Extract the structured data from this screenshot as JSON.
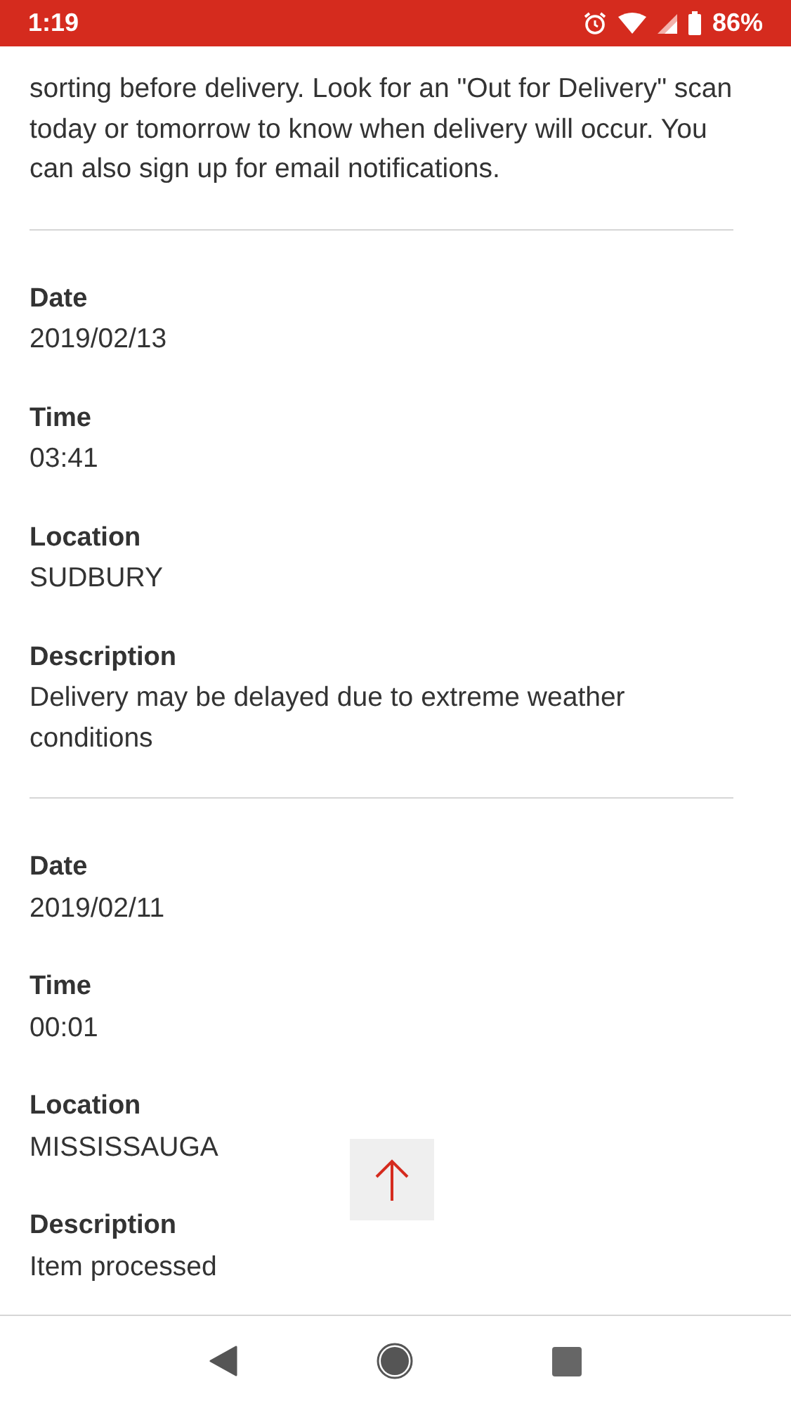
{
  "status_bar": {
    "time": "1:19",
    "battery": "86%"
  },
  "notice": "sorting before delivery. Look for an \"Out for Delivery\" scan today or tomorrow to know when delivery will occur. You can also sign up for email notifications.",
  "events": [
    {
      "fields": [
        {
          "label": "Date",
          "value": "2019/02/13"
        },
        {
          "label": "Time",
          "value": "03:41"
        },
        {
          "label": "Location",
          "value": "SUDBURY"
        },
        {
          "label": "Description",
          "value": "Delivery may be delayed due to extreme weather conditions"
        }
      ]
    },
    {
      "fields": [
        {
          "label": "Date",
          "value": "2019/02/11"
        },
        {
          "label": "Time",
          "value": "00:01"
        },
        {
          "label": "Location",
          "value": "MISSISSAUGA"
        },
        {
          "label": "Description",
          "value": "Item processed"
        }
      ]
    }
  ]
}
